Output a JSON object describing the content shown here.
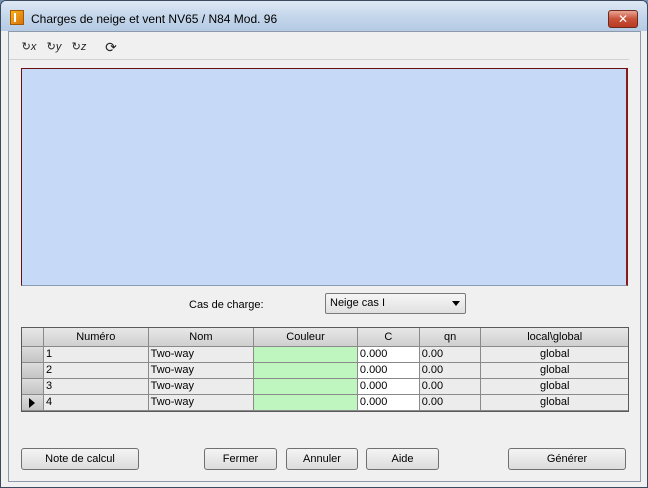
{
  "window": {
    "title": "Charges de neige et vent  NV65 / N84 Mod. 96",
    "close_glyph": "✕"
  },
  "toolbar": {
    "buttons": [
      {
        "name": "rotate-x-icon",
        "glyph": "↻x"
      },
      {
        "name": "rotate-y-icon",
        "glyph": "↻y"
      },
      {
        "name": "rotate-z-icon",
        "glyph": "↻z"
      },
      {
        "name": "refresh-view-icon",
        "glyph": "⟳"
      }
    ]
  },
  "load_case": {
    "label": "Cas de charge:",
    "selected": "Neige cas I"
  },
  "table": {
    "headers": {
      "numero": "Numéro",
      "nom": "Nom",
      "couleur": "Couleur",
      "c": "C",
      "qn": "qn",
      "local_global": "local\\global"
    },
    "rows": [
      {
        "numero": "1",
        "nom": "Two-way",
        "c": "0.000",
        "qn": "0.00",
        "local_global": "global",
        "current": false
      },
      {
        "numero": "2",
        "nom": "Two-way",
        "c": "0.000",
        "qn": "0.00",
        "local_global": "global",
        "current": false
      },
      {
        "numero": "3",
        "nom": "Two-way",
        "c": "0.000",
        "qn": "0.00",
        "local_global": "global",
        "current": false
      },
      {
        "numero": "4",
        "nom": "Two-way",
        "c": "0.000",
        "qn": "0.00",
        "local_global": "global",
        "current": true
      }
    ],
    "colors": {
      "couleur_cell": "#bff5bf"
    }
  },
  "buttons": {
    "note_calcul": "Note de calcul",
    "fermer": "Fermer",
    "annuler": "Annuler",
    "aide": "Aide",
    "generer": "Générer"
  }
}
